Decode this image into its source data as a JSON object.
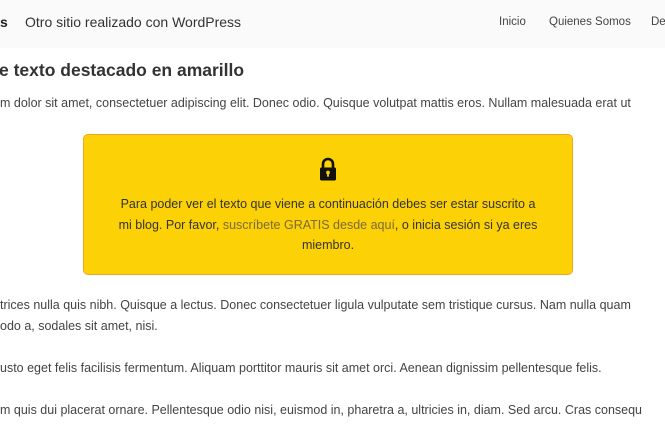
{
  "header": {
    "site_title": "s",
    "site_description": "Otro sitio realizado con WordPress",
    "nav": {
      "inicio": "Inicio",
      "quienes_somos": "Quienes Somos",
      "truncated_item": "Des"
    }
  },
  "post": {
    "heading": "e texto destacado en amarillo",
    "paragraph_1": "m dolor sit amet, consectetuer adipiscing elit. Donec odio. Quisque volutpat mattis eros. Nullam malesuada erat ut",
    "notice": {
      "icon": "lock-icon",
      "line_1": "Para poder ver el texto que viene a continuación debes ser estar suscrito a",
      "line_2_before": "mi blog. Por favor, ",
      "link_text": "suscríbete GRATIS desde aquí",
      "line_2_after": ", o inicia sesión si ya eres",
      "line_3": "miembro.",
      "background_color": "#fcd106",
      "border_color": "#f0a623"
    },
    "paragraph_2_line_1": "trices nulla quis nibh. Quisque a lectus. Donec consectetuer ligula vulputate sem tristique cursus. Nam nulla quam",
    "paragraph_2_line_2": "odo a, sodales sit amet, nisi.",
    "paragraph_3": "usto eget felis facilisis fermentum. Aliquam porttitor mauris sit amet orci. Aenean dignissim pellentesque felis.",
    "paragraph_4": "m quis dui placerat ornare. Pellentesque odio nisi, euismod in, pharetra a, ultricies in, diam. Sed arcu. Cras consequ"
  }
}
